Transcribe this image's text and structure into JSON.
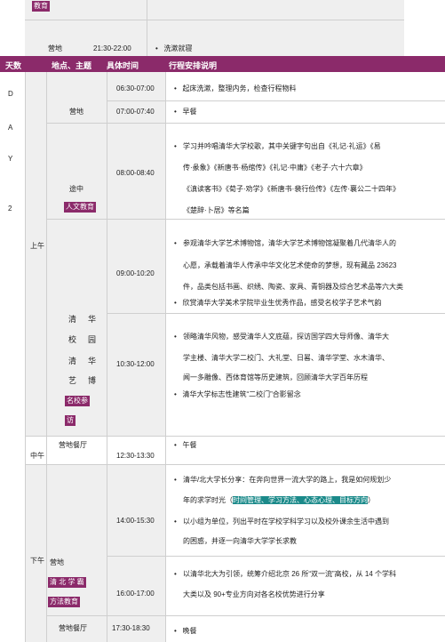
{
  "top": {
    "tag": "教育",
    "place": "营地",
    "time": "21:30-22:00",
    "bullet": "洗漱就寝"
  },
  "header": {
    "day": "天数",
    "place": "地点、主题",
    "time": "具体时间",
    "plan": "行程安排说明"
  },
  "day_letters": [
    "D",
    "A",
    "Y",
    "2"
  ],
  "periods": {
    "morning": "上午",
    "noon": "中午",
    "afternoon": "下午"
  },
  "rows": {
    "r1": {
      "time": "06:30-07:00",
      "bullet": "起床洗漱，整理内务，检查行程物料"
    },
    "r2": {
      "place": "营地",
      "time": "07:00-07:40",
      "bullet": "早餐"
    },
    "r3": {
      "place": "途中",
      "tag": "人文教育",
      "time": "08:00-08:40",
      "lines": [
        "学习并吟唱清华大学校歌，其中关键字句出自《礼记·礼运》《易",
        "传·彖象》《新唐书·杨绾传》《礼记·中庸》《老子·六十六章》",
        "《滇读客书》《荀子·劝学》《新唐书·裴行俭传》《左传·襄公二十四年》",
        "《楚辞·卜居》等名篇"
      ]
    },
    "r4": {
      "time": "09:00-10:20",
      "lines": [
        "参观清华大学艺术博物馆，清华大学艺术博物馆凝聚着几代清华人的",
        "心愿，承载着清华人传承中华文化艺术使命的梦想，现有藏品 23623",
        "件，品类包括书画、织绣、陶瓷、家具、青铜器及综合艺术品等六大类"
      ],
      "bullet2": "欣赏清华大学美术学院毕业生优秀作品，感受名校学子艺术气韵"
    },
    "r5": {
      "place_chars": [
        "清",
        "华",
        "校",
        "园",
        "清",
        "华",
        "艺",
        "博"
      ],
      "tag_lines": [
        "名校参",
        "访"
      ],
      "time": "10:30-12:00",
      "lines": [
        "领略清华风物，感受清华人文底蕴，探访国学四大导师像、清华大",
        "学主楼、清华大学二校门、大礼堂、日晷、清华学堂、水木清华、",
        "闻一多雕像、西体育馆等历史建筑，回顾清华大学百年历程"
      ],
      "bullet2": "清华大学标志性建筑“二校门”合影留念"
    },
    "r6": {
      "place": "营地餐厅",
      "time": "12:30-13:30",
      "bullet": "午餐"
    },
    "r7": {
      "time": "14:00-15:30",
      "line1": "清华/北大学长分享：在奔向世界一流大学的路上，我是如何规划少",
      "line2_pre": "年的求学时光（",
      "line2_hl": "时间管理、学习方法、心态心理、目标方向",
      "line2_post": "）",
      "bullet2_lines": [
        "以小组为单位，列出平时在学校学科学习以及校外课余生活中遇到",
        "的困惑，并逐一向清华大学学长求教"
      ]
    },
    "r8": {
      "place": "营地",
      "tag_lines": [
        "清 北 学 霸",
        "方法教育"
      ],
      "time": "16:00-17:00",
      "lines": [
        "以清华北大为引领，统筹介绍北京 26 所“双一流”高校，从 14 个学科",
        "大类以及 90+专业方向对各名校优势进行分享"
      ]
    },
    "r9": {
      "place": "营地餐厅",
      "time": "17:30-18:30",
      "bullet": "晚餐"
    }
  },
  "colors": {
    "accent": "#8b2a6a",
    "highlight": "#1b8a8a",
    "cell_grey": "#efefef"
  }
}
